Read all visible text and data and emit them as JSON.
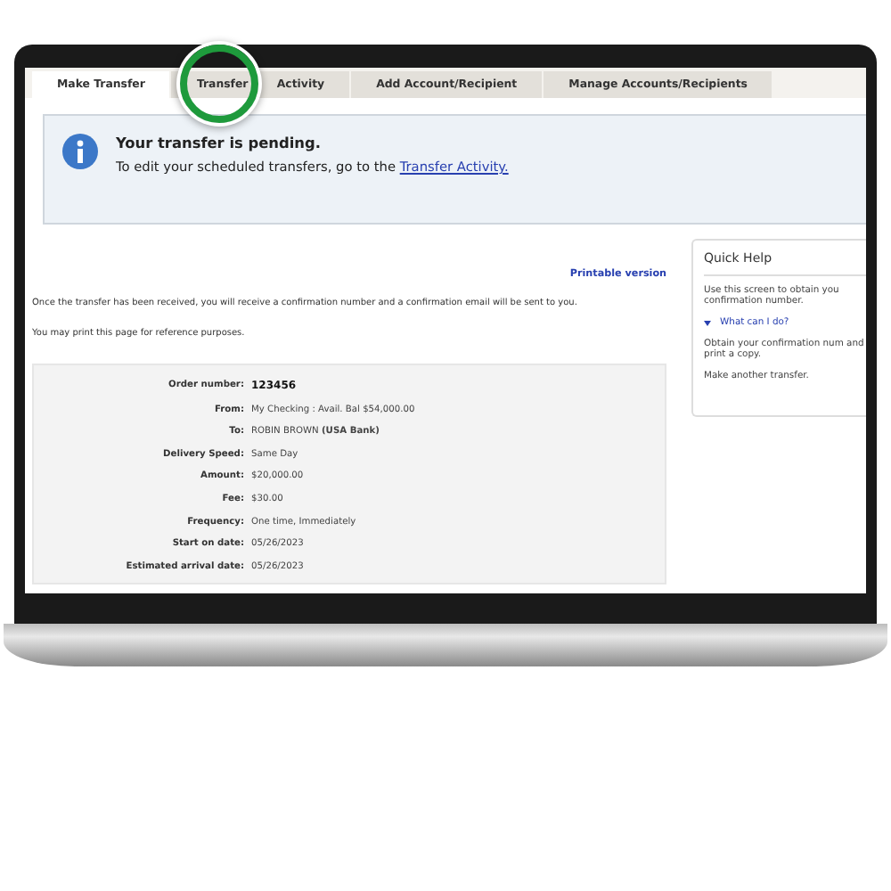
{
  "tabs": [
    {
      "label": "Make Transfer",
      "selected": true,
      "highlighted": false
    },
    {
      "label": "Transfer Activity",
      "selected": false,
      "highlighted": true
    },
    {
      "label": "Add Account/Recipient",
      "selected": false,
      "highlighted": false
    },
    {
      "label": "Manage Accounts/Recipients",
      "selected": false,
      "highlighted": false
    }
  ],
  "notice": {
    "title": "Your transfer is pending.",
    "text": "To edit your scheduled transfers, go to the",
    "link": "Transfer Activity."
  },
  "printable_link": "Printable version",
  "paragraphs": [
    "Once the transfer has been received, you will receive a confirmation number and a confirmation email will be sent to you.",
    "You may print this page for reference purposes."
  ],
  "details": [
    {
      "label": "Order number:",
      "value": "123456",
      "bold": true
    },
    {
      "label": "From:",
      "value": "My Checking : Avail. Bal $54,000.00",
      "bold": false
    },
    {
      "label": "To:",
      "value": "ROBIN BROWN  **(USA Bank)**",
      "bold": false
    },
    {
      "label": "Delivery Speed:",
      "value": "Same Day",
      "bold": false
    },
    {
      "label": "Amount:",
      "value": "$20,000.00",
      "bold": false
    },
    {
      "label": "Fee:",
      "value": "$30.00",
      "bold": false
    },
    {
      "label": "Frequency:",
      "value": "One time, Immediately",
      "bold": false
    },
    {
      "label": "Start on date:",
      "value": "05/26/2023",
      "bold": false
    },
    {
      "label": "Estimated arrival date:",
      "value": "05/26/2023",
      "bold": false
    }
  ],
  "quick_help": {
    "title": "Quick Help",
    "items": [
      {
        "kind": "text",
        "text": "Use this screen to obtain you confirmation number."
      },
      {
        "kind": "link",
        "text": "What can I do?"
      },
      {
        "kind": "text",
        "text": "Obtain your confirmation num and print a copy."
      },
      {
        "kind": "text",
        "text": "Make another transfer."
      }
    ]
  }
}
